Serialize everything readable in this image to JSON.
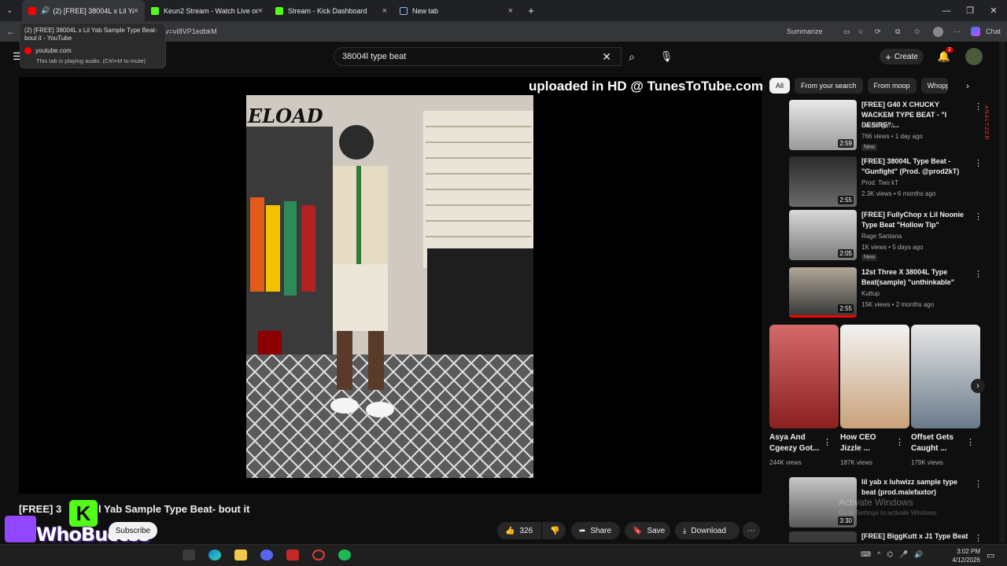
{
  "browser": {
    "tabs": [
      {
        "title": "(2) [FREE] 38004L x Lil Yab Sa...",
        "color": "#ff0000"
      },
      {
        "title": "Keun2 Stream - Watch Live on Kick",
        "color": "#53fc18"
      },
      {
        "title": "Stream - Kick Dashboard",
        "color": "#53fc18"
      },
      {
        "title": "New tab",
        "color": "#8ab4f8"
      }
    ],
    "url_fragment": "v=vI8VP1edbkM",
    "summarize_label": "Summarize",
    "chat_label": "Chat",
    "tooltip": {
      "title": "(2) [FREE] 38004L x Lil Yab Sample Type Beat- bout it - YouTube",
      "domain": "youtube.com",
      "note": "This tab is playing audio. (Ctrl+M to mute)"
    }
  },
  "youtube": {
    "search_value": "38004l type beat",
    "create_label": "Create",
    "notif_count": "2",
    "watermark": "uploaded in HD @ TunesToTube.com",
    "poster_text": "ELOAD",
    "video_title_visible": "[FREE] 3",
    "video_title_tail": "il Yab Sample Type Beat- bout it",
    "subscribe_label": "Subscribe",
    "likes": "326",
    "share_label": "Share",
    "save_label": "Save",
    "download_label": "Download",
    "overlay_name": "WhoBuccss",
    "chips": [
      "All",
      "From your search",
      "From moop",
      "Whopp"
    ],
    "recommendations": [
      {
        "title": "[FREE] G40 X CHUCKY WACKEM TYPE BEAT - \"I DESIRE\" ...",
        "channel": "Earbangerz",
        "meta": "766 views • 1 day ago",
        "badge": "New",
        "duration": "2:59"
      },
      {
        "title": "[FREE] 38004L Type Beat - \"Gunfight\" (Prod. @prod2kT)",
        "channel": "Prod. Two kT",
        "meta": "2.3K views • 6 months ago",
        "badge": "",
        "duration": "2:55"
      },
      {
        "title": "[FREE] FullyChop x Lil Noonie Type Beat \"Hollow Tip\"",
        "channel": "Rage Santana",
        "meta": "1K views • 5 days ago",
        "badge": "New",
        "duration": "2:05"
      },
      {
        "title": "12st Three X 38004L Type Beat(sample) \"unthinkable\"",
        "channel": "Kuttup",
        "meta": "15K views • 2 months ago",
        "badge": "",
        "duration": "2:55"
      },
      {
        "title": "lil yab x luhwizz sample type beat (prod.malefaxtor)",
        "channel": "",
        "meta": "",
        "badge": "",
        "duration": "3:30"
      },
      {
        "title": "[FREE] BiggKutt x J1 Type Beat",
        "channel": "",
        "meta": "",
        "badge": "",
        "duration": ""
      }
    ],
    "shorts": [
      {
        "title": "Asya And Cgeezy Got...",
        "views": "244K views"
      },
      {
        "title": "How CEO Jizzle ...",
        "views": "187K views"
      },
      {
        "title": "Offset Gets Caught ...",
        "views": "179K views"
      }
    ],
    "side_label": "ANALYZER"
  },
  "windows": {
    "activate_title": "Activate Windows",
    "activate_sub": "Go to Settings to activate Windows.",
    "time": "3:02 PM",
    "date": "4/12/2026"
  }
}
